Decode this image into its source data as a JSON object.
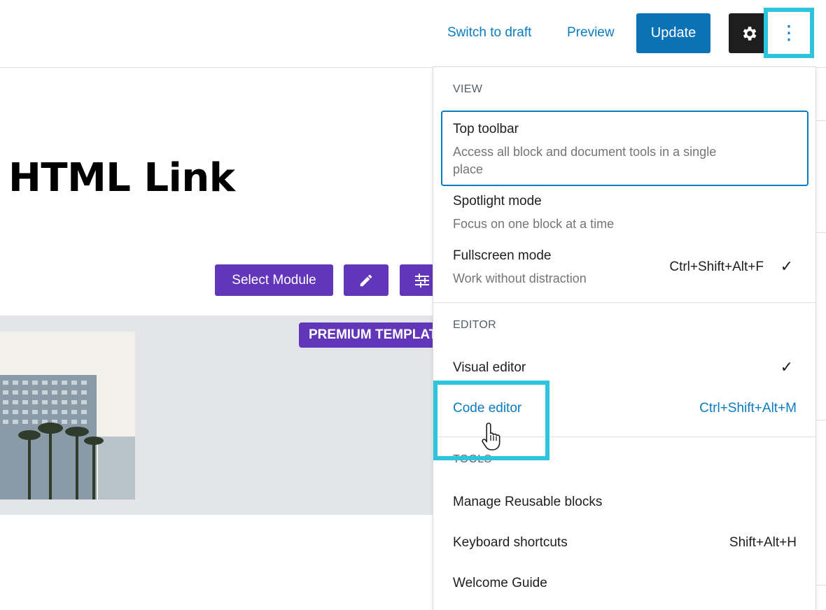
{
  "topbar": {
    "switch_to_draft": "Switch to draft",
    "preview": "Preview",
    "update": "Update",
    "settings_icon": "gear-icon",
    "more_icon": "vertical-ellipsis-icon",
    "more_glyph": "⋮"
  },
  "post": {
    "title": "HTML Link"
  },
  "module_toolbar": {
    "select_module": "Select Module",
    "edit_icon": "pencil-icon",
    "settings_icon": "sliders-icon"
  },
  "template_preview": {
    "badge": "PREMIUM TEMPLATE",
    "image": "hotel-building-photo"
  },
  "menu": {
    "view": {
      "label": "VIEW",
      "items": [
        {
          "title": "Top toolbar",
          "desc": "Access all block and document tools in a single place"
        },
        {
          "title": "Spotlight mode",
          "desc": "Focus on one block at a time"
        },
        {
          "title": "Fullscreen mode",
          "desc": "Work without distraction",
          "shortcut": "Ctrl+Shift+Alt+F",
          "check": "✓"
        }
      ]
    },
    "editor": {
      "label": "EDITOR",
      "items": [
        {
          "title": "Visual editor",
          "check": "✓"
        },
        {
          "title": "Code editor",
          "shortcut": "Ctrl+Shift+Alt+M"
        }
      ]
    },
    "tools": {
      "label": "TOOLS",
      "items": [
        {
          "title": "Manage Reusable blocks"
        },
        {
          "title": "Keyboard shortcuts",
          "shortcut": "Shift+Alt+H"
        },
        {
          "title": "Welcome Guide"
        }
      ]
    }
  },
  "colors": {
    "accent_blue": "#0a7cbf",
    "update_bg": "#0a72b5",
    "module_purple": "#6236b8",
    "highlight_cyan": "#2ec4dd"
  }
}
